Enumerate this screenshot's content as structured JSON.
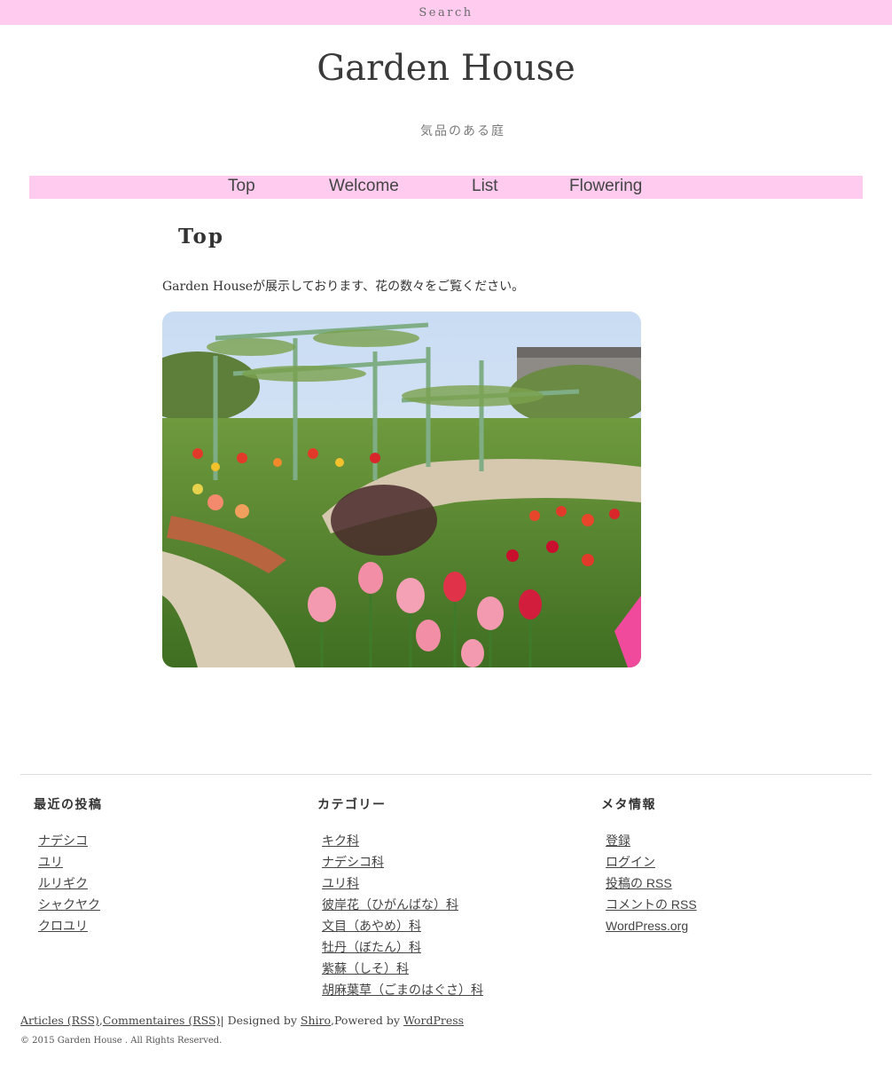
{
  "topbar": {
    "search_label": "Search"
  },
  "header": {
    "title": "Garden House",
    "description": "気品のある庭"
  },
  "nav": {
    "items": [
      {
        "label": "Top"
      },
      {
        "label": "Welcome"
      },
      {
        "label": "List"
      },
      {
        "label": "Flowering"
      }
    ]
  },
  "main": {
    "heading": "Top",
    "intro": "Garden Houseが展示しております、花の数々をご覧ください。",
    "image_subject": "flower-garden-photo"
  },
  "footer": {
    "widgets": {
      "recent_posts": {
        "title": "最近の投稿",
        "items": [
          "ナデシコ",
          "ユリ",
          "ルリギク",
          "シャクヤク",
          "クロユリ"
        ]
      },
      "categories": {
        "title": "カテゴリー",
        "items": [
          "キク科",
          "ナデシコ科",
          "ユリ科",
          "彼岸花（ひがんばな）科",
          "文目（あやめ）科",
          "牡丹（ぼたん）科",
          "紫蘇（しそ）科",
          "胡麻葉草（ごまのはぐさ）科"
        ]
      },
      "meta": {
        "title": "メタ情報",
        "items": [
          "登録",
          "ログイン",
          "投稿の RSS",
          "コメントの RSS",
          "WordPress.org"
        ]
      }
    },
    "credits": {
      "articles_rss": "Articles (RSS)",
      "comments_rss": "Commentaires (RSS)",
      "sep": "| Designed by ",
      "designer": "Shiro",
      "powered": ",Powered by ",
      "platform": "WordPress"
    },
    "copyright": "© 2015 Garden House . All Rights Reserved."
  },
  "colors": {
    "accent_pink": "#ffcbee",
    "text": "#333333"
  }
}
